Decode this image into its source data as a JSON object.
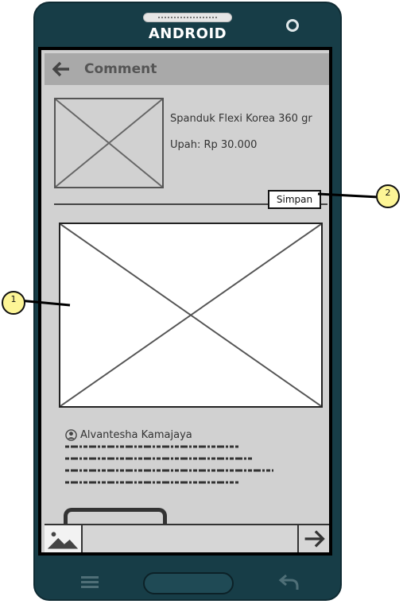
{
  "device": {
    "brand_label": "ANDROID"
  },
  "header": {
    "title": "Comment"
  },
  "product": {
    "name": "Spanduk Flexi Korea 360 gr",
    "price_label": "Upah: Rp 30.000"
  },
  "actions": {
    "save_label": "Simpan"
  },
  "comment": {
    "author": "Alvantesha Kamajaya"
  },
  "callouts": [
    {
      "number": "1"
    },
    {
      "number": "2"
    }
  ],
  "colors": {
    "phone_body": "#173d47",
    "screen_bg": "#d1d1d1",
    "appbar_bg": "#a9a9a9",
    "callout_fill": "#fdf596"
  }
}
